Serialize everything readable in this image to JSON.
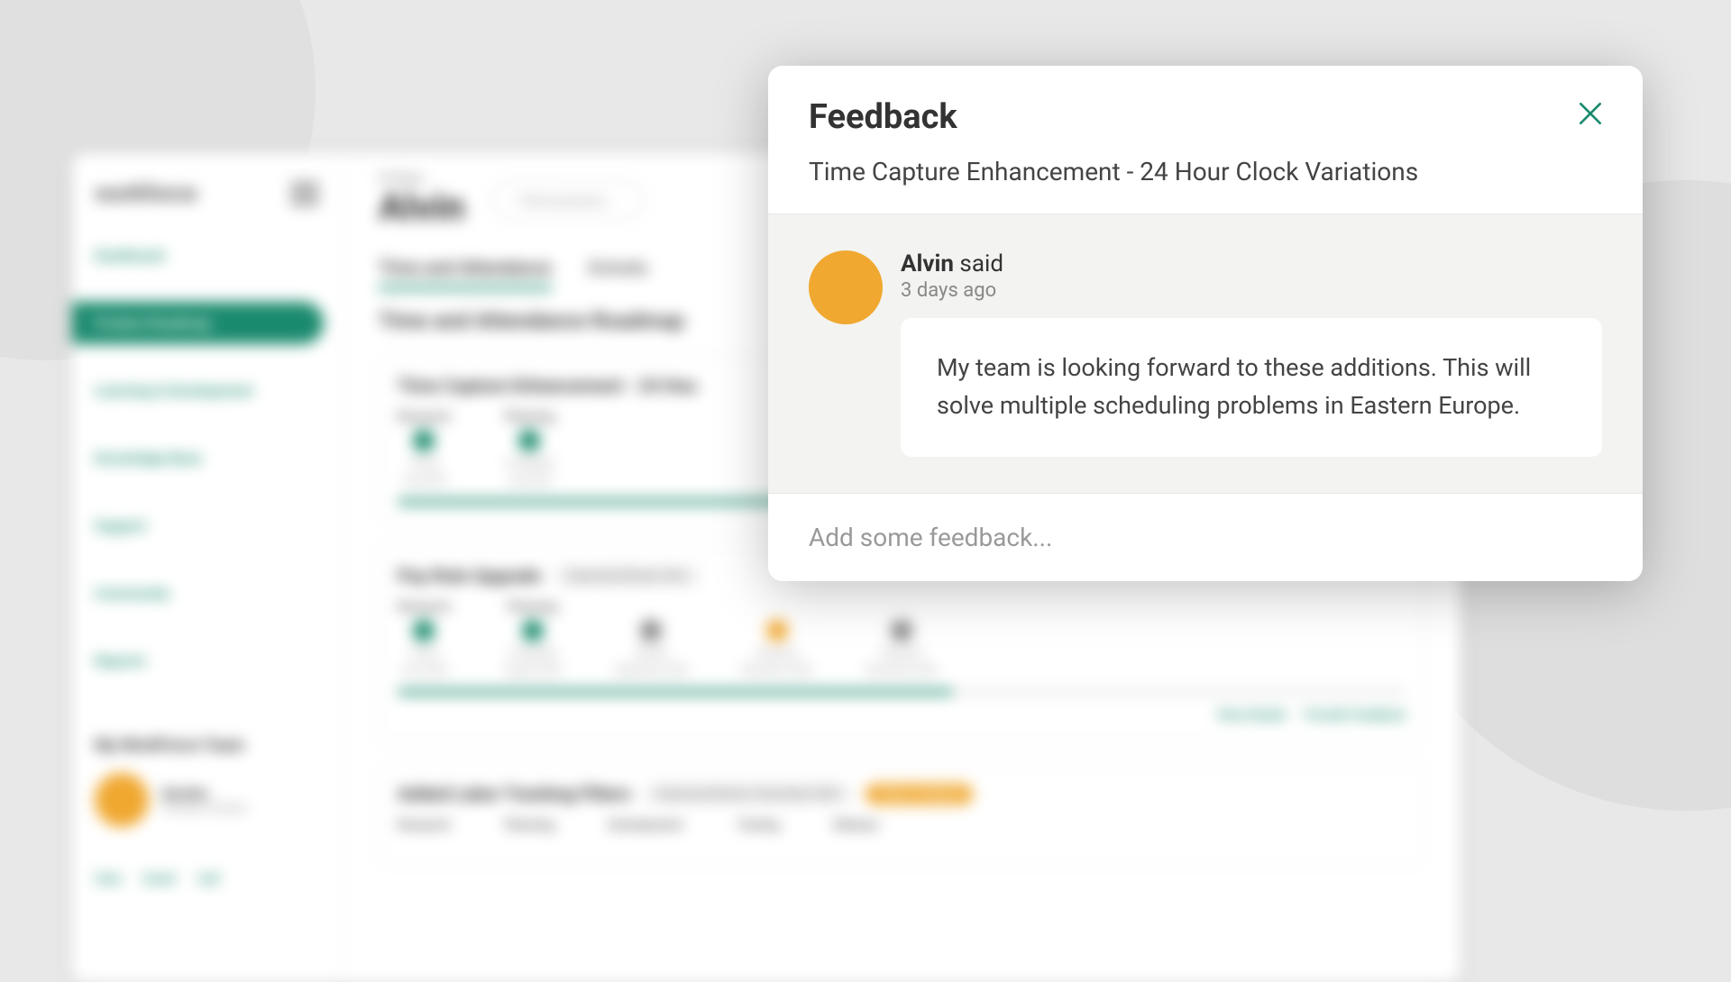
{
  "background": {
    "logo": "workforce",
    "greeting_label": "Hi there,",
    "user_name": "Alvin",
    "search_placeholder": "Find answers...",
    "nav": {
      "items": [
        {
          "label": "Dashboard"
        },
        {
          "label": "Product Roadmap"
        },
        {
          "label": "Learning & Development"
        },
        {
          "label": "Knowledge Base"
        },
        {
          "label": "Support"
        },
        {
          "label": "Community"
        },
        {
          "label": "Reports"
        }
      ]
    },
    "team": {
      "header": "My WorkForce Team",
      "member_name": "Kendra",
      "member_role": "Primary Contact",
      "contact": {
        "chat": "Chat",
        "email": "Email",
        "call": "Call"
      }
    },
    "tabs": {
      "0": "Time and Attendance",
      "1": "Schedu"
    },
    "section_title": "Time and Attendance Roadmap",
    "card1": {
      "title": "Time Capture Enhancement - 24 Hou",
      "stage1_label": "Research",
      "stage1_status": "Actual",
      "stage1_date": "July 2024",
      "stage2_label": "Planning",
      "stage2_status": "Completed",
      "stage2_date": "July 2024"
    },
    "card2": {
      "title": "Pay Rule Upgrade",
      "badge": "Expected Delivery: Nov",
      "stage1_label": "Research",
      "stage1_status": "Actual",
      "stage1_date": "June 2024",
      "stage2_label": "Planning",
      "stage2_status": "Completed",
      "stage2_date": "August 2024",
      "stage3_status": "Started",
      "stage3_date": "September 2024",
      "stage4_status": "Expected",
      "stage4_date": "November 2024",
      "stage5_status": "Expected",
      "stage5_date": "November 2024",
      "action_view": "View Details",
      "action_feedback": "Provide Feedback"
    },
    "card3": {
      "title": "Added Labor Tracking Filters",
      "badge1": "Expected Delivery: December 2024",
      "badge2": "Status: Delayed",
      "stage1_label": "Research",
      "stage2_label": "Planning",
      "stage3_label": "Development",
      "stage4_label": "Testing",
      "stage5_label": "Release"
    }
  },
  "modal": {
    "title": "Feedback",
    "subtitle": "Time Capture Enhancement - 24 Hour Clock Variations",
    "comment": {
      "author": "Alvin",
      "said": " said",
      "time": "3 days ago",
      "body": "My team is looking forward to these additions. This will solve multiple scheduling problems in Eastern Europe."
    },
    "input_placeholder": "Add some feedback..."
  }
}
